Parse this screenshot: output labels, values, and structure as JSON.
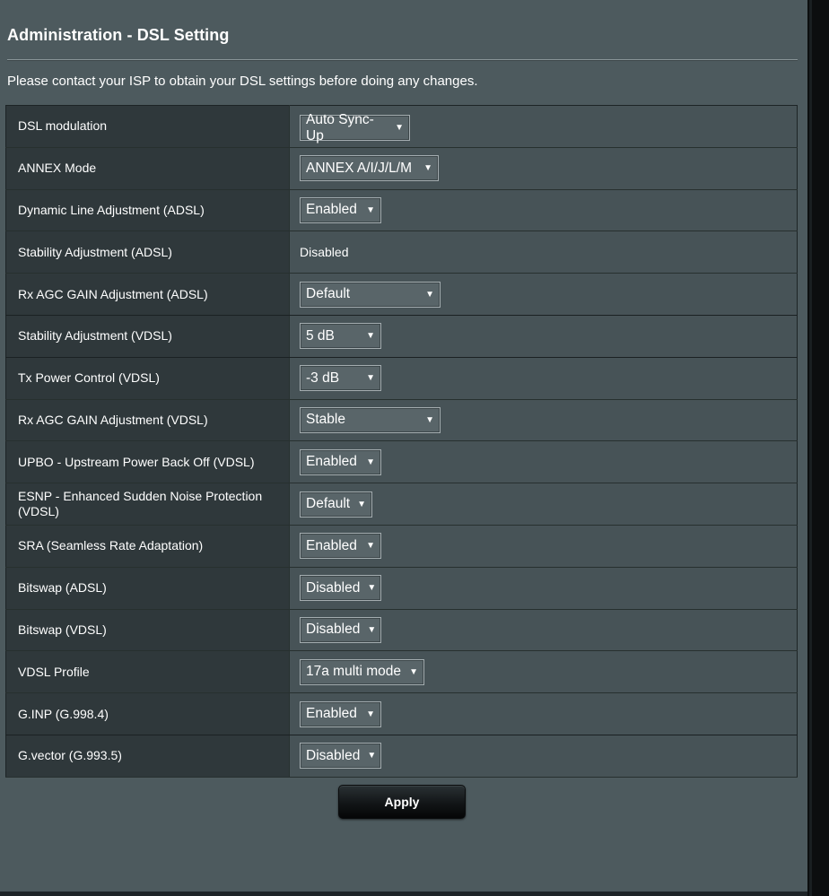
{
  "page": {
    "title": "Administration - DSL Setting",
    "intro": "Please contact your ISP to obtain your DSL settings before doing any changes."
  },
  "settings": [
    {
      "label": "DSL modulation",
      "value": "Auto Sync-Up",
      "type": "select"
    },
    {
      "label": "ANNEX Mode",
      "value": "ANNEX A/I/J/L/M",
      "type": "select"
    },
    {
      "label": "Dynamic Line Adjustment (ADSL)",
      "value": "Enabled",
      "type": "select"
    },
    {
      "label": "Stability Adjustment (ADSL)",
      "value": "Disabled",
      "type": "static"
    },
    {
      "label": "Rx AGC GAIN Adjustment (ADSL)",
      "value": "Default",
      "type": "select"
    },
    {
      "label": "Stability Adjustment (VDSL)",
      "value": "5 dB",
      "type": "select"
    },
    {
      "label": "Tx Power Control (VDSL)",
      "value": "-3 dB",
      "type": "select"
    },
    {
      "label": "Rx AGC GAIN Adjustment (VDSL)",
      "value": "Stable",
      "type": "select"
    },
    {
      "label": "UPBO - Upstream Power Back Off (VDSL)",
      "value": "Enabled",
      "type": "select"
    },
    {
      "label": "ESNP - Enhanced Sudden Noise Protection (VDSL)",
      "value": "Default",
      "type": "select"
    },
    {
      "label": "SRA (Seamless Rate Adaptation)",
      "value": "Enabled",
      "type": "select"
    },
    {
      "label": "Bitswap (ADSL)",
      "value": "Disabled",
      "type": "select"
    },
    {
      "label": "Bitswap (VDSL)",
      "value": "Disabled",
      "type": "select"
    },
    {
      "label": "VDSL Profile",
      "value": "17a multi mode",
      "type": "select"
    },
    {
      "label": "G.INP (G.998.4)",
      "value": "Enabled",
      "type": "select"
    },
    {
      "label": "G.vector (G.993.5)",
      "value": "Disabled",
      "type": "select"
    }
  ],
  "actions": {
    "apply_label": "Apply"
  },
  "icons": {
    "dropdown": "caret-down-icon"
  },
  "colors": {
    "page_bg": "#4d5a5e",
    "label_bg": "#2f383b",
    "value_bg": "#475357",
    "select_bg": "#596569",
    "button_bg": "#121517"
  }
}
